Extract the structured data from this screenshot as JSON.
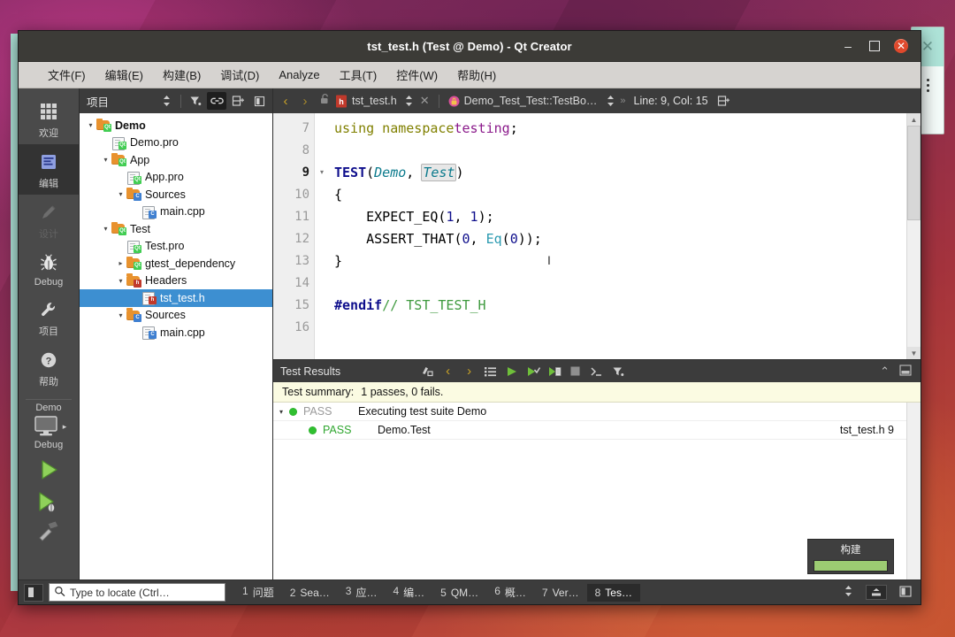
{
  "window": {
    "title": "tst_test.h (Test @ Demo) - Qt Creator",
    "minimize": "–",
    "maximize": "",
    "close": "✕"
  },
  "background_window": {
    "close": "✕"
  },
  "menubar": [
    {
      "label": "文件(F)",
      "mnemonic": "F"
    },
    {
      "label": "编辑(E)",
      "mnemonic": "E"
    },
    {
      "label": "构建(B)",
      "mnemonic": "B"
    },
    {
      "label": "调试(D)",
      "mnemonic": "D"
    },
    {
      "label": "Analyze",
      "mnemonic": "A"
    },
    {
      "label": "工具(T)",
      "mnemonic": "T"
    },
    {
      "label": "控件(W)",
      "mnemonic": "W"
    },
    {
      "label": "帮助(H)",
      "mnemonic": "H"
    }
  ],
  "modebar": {
    "modes": [
      {
        "label": "欢迎",
        "icon": "grid-icon",
        "selected": false,
        "disabled": false
      },
      {
        "label": "编辑",
        "icon": "edit-icon",
        "selected": true,
        "disabled": false
      },
      {
        "label": "设计",
        "icon": "pencil-icon",
        "selected": false,
        "disabled": true
      },
      {
        "label": "Debug",
        "icon": "bug-icon",
        "selected": false,
        "disabled": false
      },
      {
        "label": "项目",
        "icon": "wrench-icon",
        "selected": false,
        "disabled": false
      },
      {
        "label": "帮助",
        "icon": "help-icon",
        "selected": false,
        "disabled": false
      }
    ],
    "kit": {
      "project": "Demo",
      "config": "Debug",
      "icon": "monitor-icon"
    },
    "run_label": "run-button",
    "debug_label": "debug-button",
    "build_label": "build-button"
  },
  "project_pane": {
    "title": "项目",
    "tools": [
      {
        "name": "filter-icon",
        "glyph": "▼",
        "active": false
      },
      {
        "name": "link-icon",
        "glyph": "⚭",
        "active": true
      },
      {
        "name": "collapse-all-icon",
        "glyph": "⊖",
        "active": false
      },
      {
        "name": "sidebar-split-icon",
        "glyph": "▣",
        "active": false
      }
    ],
    "tree": [
      {
        "label": "Demo",
        "indent": 0,
        "arrow": "down",
        "icon": "folder-qt",
        "bold": true,
        "selected": false
      },
      {
        "label": "Demo.pro",
        "indent": 1,
        "arrow": "none",
        "icon": "file-qt",
        "bold": false,
        "selected": false
      },
      {
        "label": "App",
        "indent": 1,
        "arrow": "down",
        "icon": "folder-qt",
        "bold": false,
        "selected": false
      },
      {
        "label": "App.pro",
        "indent": 2,
        "arrow": "none",
        "icon": "file-qt",
        "bold": false,
        "selected": false
      },
      {
        "label": "Sources",
        "indent": 2,
        "arrow": "down",
        "icon": "folder-cpp",
        "bold": false,
        "selected": false
      },
      {
        "label": "main.cpp",
        "indent": 3,
        "arrow": "none",
        "icon": "file-cpp",
        "bold": false,
        "selected": false
      },
      {
        "label": "Test",
        "indent": 1,
        "arrow": "down",
        "icon": "folder-qt",
        "bold": false,
        "selected": false
      },
      {
        "label": "Test.pro",
        "indent": 2,
        "arrow": "none",
        "icon": "file-qt",
        "bold": false,
        "selected": false
      },
      {
        "label": "gtest_dependency",
        "indent": 2,
        "arrow": "right",
        "icon": "folder-qt",
        "bold": false,
        "selected": false
      },
      {
        "label": "Headers",
        "indent": 2,
        "arrow": "down",
        "icon": "folder-h",
        "bold": false,
        "selected": false
      },
      {
        "label": "tst_test.h",
        "indent": 3,
        "arrow": "none",
        "icon": "file-h",
        "bold": false,
        "selected": true
      },
      {
        "label": "Sources",
        "indent": 2,
        "arrow": "down",
        "icon": "folder-cpp",
        "bold": false,
        "selected": false
      },
      {
        "label": "main.cpp",
        "indent": 3,
        "arrow": "none",
        "icon": "file-cpp",
        "bold": false,
        "selected": false
      }
    ]
  },
  "editor_bar": {
    "back": "‹",
    "forward": "›",
    "lock_icon": "unlock-icon",
    "file_icon": "header-file-icon",
    "filename": "tst_test.h",
    "close": "✕",
    "symbol": "Demo_Test_Test::TestBo…",
    "position": "Line: 9, Col: 15",
    "split_icon": "split-editor-icon"
  },
  "editor": {
    "first_line": 7,
    "current_line": 9,
    "lines": [
      {
        "n": 7,
        "fold": "",
        "text": "using namespace testing;"
      },
      {
        "n": 8,
        "fold": "",
        "text": ""
      },
      {
        "n": 9,
        "fold": "▾",
        "text": "TEST(Demo, Test)"
      },
      {
        "n": 10,
        "fold": "",
        "text": "{"
      },
      {
        "n": 11,
        "fold": "",
        "text": "    EXPECT_EQ(1, 1);"
      },
      {
        "n": 12,
        "fold": "",
        "text": "    ASSERT_THAT(0, Eq(0));"
      },
      {
        "n": 13,
        "fold": "",
        "text": "}"
      },
      {
        "n": 14,
        "fold": "",
        "text": ""
      },
      {
        "n": 15,
        "fold": "",
        "text": "#endif // TST_TEST_H"
      },
      {
        "n": 16,
        "fold": "",
        "text": ""
      }
    ]
  },
  "test_panel": {
    "title": "Test Results",
    "tools": [
      {
        "name": "run-selected-tests-icon",
        "glyph": "⚙"
      },
      {
        "name": "previous-result-icon",
        "glyph": "‹"
      },
      {
        "name": "next-result-icon",
        "glyph": "›"
      },
      {
        "name": "expand-list-icon",
        "glyph": "≡"
      },
      {
        "name": "run-all-tests-icon",
        "glyph": "▶"
      },
      {
        "name": "run-selected-icon",
        "glyph": "▶"
      },
      {
        "name": "run-file-tests-icon",
        "glyph": "▶"
      },
      {
        "name": "stop-tests-icon",
        "glyph": "■"
      },
      {
        "name": "output-console-icon",
        "glyph": "⌫"
      },
      {
        "name": "filter-results-icon",
        "glyph": "▼"
      }
    ],
    "collapse": "⌃",
    "maximize": "▣",
    "summary_label": "Test summary:",
    "summary_value": "1 passes, 0 fails.",
    "rows": [
      {
        "expand": "▾",
        "status": "PASS",
        "status_dim": true,
        "name": "Executing test suite Demo",
        "location": ""
      },
      {
        "expand": "",
        "status": "PASS",
        "status_dim": false,
        "name": "Demo.Test",
        "location": "tst_test.h 9"
      }
    ]
  },
  "build_popup": {
    "label": "构建",
    "progress": 100
  },
  "statusbar": {
    "sidebar_toggle": "sidebar-toggle-icon",
    "locator_placeholder": "Type to locate (Ctrl…",
    "locator_value": "",
    "search_icon": "search-icon",
    "tabs": [
      {
        "n": "1",
        "label": "问题",
        "active": false
      },
      {
        "n": "2",
        "label": "Sea…",
        "active": false
      },
      {
        "n": "3",
        "label": "应…",
        "active": false
      },
      {
        "n": "4",
        "label": "编…",
        "active": false
      },
      {
        "n": "5",
        "label": "QM…",
        "active": false
      },
      {
        "n": "6",
        "label": "概…",
        "active": false
      },
      {
        "n": "7",
        "label": "Ver…",
        "active": false
      },
      {
        "n": "8",
        "label": "Tes…",
        "active": true
      }
    ],
    "spinner": "⇅",
    "progress_icon": "progress-details-icon",
    "right_toggle": "output-pane-toggle-icon"
  },
  "colors": {
    "accent_selection": "#3d8fd1",
    "pass_green": "#2fa62f",
    "title_bar": "#3c3b37",
    "close_red": "#e0492c",
    "summary_bg": "#fbfbe2"
  }
}
